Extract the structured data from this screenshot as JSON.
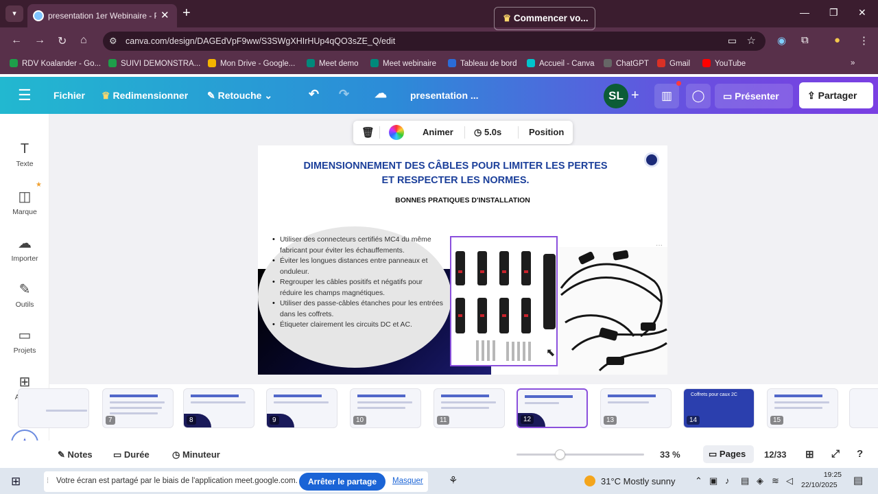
{
  "browser": {
    "tab_title": "presentation 1er Webinaire - P",
    "url": "canva.com/design/DAGEdVpF9ww/S3SWgXHIrHUp4qQO3sZE_Q/edit",
    "bookmarks": [
      {
        "label": "RDV Koalander - Go...",
        "color": "#1e9e4a"
      },
      {
        "label": "SUIVI DEMONSTRA...",
        "color": "#1e9e4a"
      },
      {
        "label": "Mon Drive - Google...",
        "color": "#f4b400"
      },
      {
        "label": "Meet demo",
        "color": "#00897b"
      },
      {
        "label": "Meet webinaire",
        "color": "#00897b"
      },
      {
        "label": "Tableau de bord",
        "color": "#2b6cd8"
      },
      {
        "label": "Accueil - Canva",
        "color": "#00c4cc"
      },
      {
        "label": "ChatGPT",
        "color": "#666666"
      },
      {
        "label": "Gmail",
        "color": "#d93025"
      },
      {
        "label": "YouTube",
        "color": "#ff0000"
      }
    ]
  },
  "canva_toolbar": {
    "file": "Fichier",
    "resize": "Redimensionner",
    "retouch": "Retouche",
    "doc_title": "presentation ...",
    "start_label": "Commencer vo...",
    "avatar_initials": "SL",
    "present": "Présenter",
    "share": "Partager"
  },
  "sidebar": {
    "items": [
      {
        "icon": "T",
        "label": "Texte"
      },
      {
        "icon": "◫",
        "label": "Marque"
      },
      {
        "icon": "☁",
        "label": "Importer"
      },
      {
        "icon": "✎",
        "label": "Outils"
      },
      {
        "icon": "▭",
        "label": "Projets"
      },
      {
        "icon": "⊞",
        "label": "Applis"
      }
    ]
  },
  "element_toolbar": {
    "animate": "Animer",
    "duration": "5.0s",
    "position": "Position"
  },
  "slide": {
    "title_line1": "DIMENSIONNEMENT DES CÂBLES POUR LIMITER LES PERTES",
    "title_line2": "ET RESPECTER LES NORMES.",
    "subtitle": "BONNES PRATIQUES D'INSTALLATION",
    "bullets": [
      "Utiliser des connecteurs certifiés MC4 du même fabricant pour éviter les échauffements.",
      "Éviter les longues distances entre panneaux et onduleur.",
      "Regrouper les câbles positifs et négatifs pour réduire les champs magnétiques.",
      "Utiliser des passe-câbles étanches pour les entrées dans les coffrets.",
      "Étiqueter clairement les circuits DC et AC."
    ]
  },
  "thumbnails": [
    {
      "num": "",
      "style": "plain"
    },
    {
      "num": "7",
      "style": "text"
    },
    {
      "num": "8",
      "style": "blob"
    },
    {
      "num": "9",
      "style": "blob"
    },
    {
      "num": "10",
      "style": "text"
    },
    {
      "num": "11",
      "style": "text"
    },
    {
      "num": "12",
      "style": "active"
    },
    {
      "num": "13",
      "style": "text"
    },
    {
      "num": "14",
      "style": "blue"
    },
    {
      "num": "15",
      "style": "text"
    },
    {
      "num": "",
      "style": "plain"
    }
  ],
  "thumb_title_14": "Coffrets pour caux 2C",
  "bottom_bar": {
    "notes": "Notes",
    "duration": "Durée",
    "timer": "Minuteur",
    "zoom": "33 %",
    "zoom_level": 0.33,
    "pages": "Pages",
    "page_count": "12/33"
  },
  "taskbar": {
    "share_notice": "Votre écran est partagé par le biais de l'application meet.google.com.",
    "stop_sharing": "Arrêter le partage",
    "hide": "Masquer",
    "weather": "31°C  Mostly sunny",
    "time": "19:25",
    "date": "22/10/2025"
  }
}
